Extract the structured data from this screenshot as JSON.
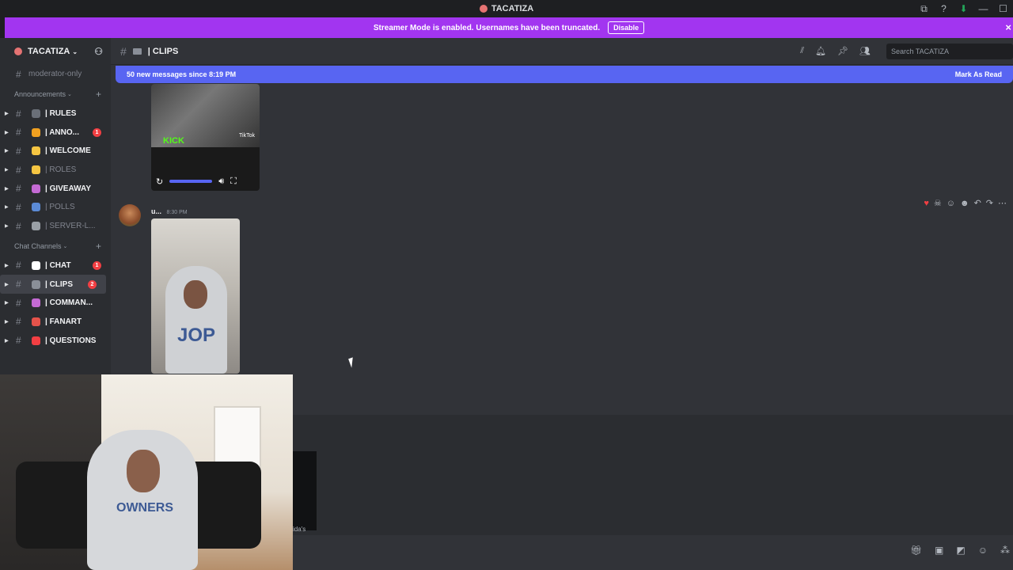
{
  "window": {
    "title": "TACATIZA",
    "controls": [
      "⧉",
      "?",
      "⬇",
      "—",
      "☐"
    ]
  },
  "banner": {
    "text": "Streamer Mode is enabled. Usernames have been truncated.",
    "button": "Disable",
    "close": "×"
  },
  "sidebar": {
    "server_name": "TACATIZA",
    "top_channel": "moderator-only",
    "categories": [
      {
        "name": "Announcements",
        "channels": [
          {
            "label": "| RULES",
            "color": "#6a6f78",
            "badge": "",
            "muted": false
          },
          {
            "label": "| ANNO...",
            "color": "#f0a020",
            "badge": "1",
            "muted": false
          },
          {
            "label": "| WELCOME",
            "color": "#f5c542",
            "badge": "",
            "muted": false
          },
          {
            "label": "| ROLES",
            "color": "#f5c542",
            "badge": "",
            "muted": true
          },
          {
            "label": "| GIVEAWAY",
            "color": "#c46ad4",
            "badge": "",
            "muted": false
          },
          {
            "label": "| POLLS",
            "color": "#5b8bd6",
            "badge": "",
            "muted": true
          },
          {
            "label": "| SERVER-L...",
            "color": "#9aa0a6",
            "badge": "",
            "muted": true
          }
        ]
      },
      {
        "name": "Chat Channels",
        "channels": [
          {
            "label": "| CHAT",
            "color": "#ffffff",
            "badge": "1",
            "muted": false,
            "active": false
          },
          {
            "label": "| CLIPS",
            "color": "#8a8f98",
            "badge": "2",
            "muted": false,
            "active": true
          },
          {
            "label": "| COMMAN...",
            "color": "#c46ad4",
            "badge": "",
            "muted": false
          },
          {
            "label": "| FANART",
            "color": "#e5534b",
            "badge": "",
            "muted": false
          },
          {
            "label": "| QUESTIONS",
            "color": "#f23f43",
            "badge": "",
            "muted": false
          }
        ]
      }
    ]
  },
  "topbar": {
    "channel": "| CLIPS",
    "search_placeholder": "Search TACATIZA"
  },
  "chat": {
    "new_messages": "50 new messages since 8:19 PM",
    "mark_read": "Mark As Read",
    "video": {
      "brand": "KICK",
      "watermark": "TikTok"
    },
    "message": {
      "author": "u...",
      "time": "8:30 PM",
      "shirt_text": "JOP"
    },
    "bottom_caption": "ida's"
  },
  "webcam": {
    "shirt_text": "OWNERS"
  },
  "colors": {
    "accent": "#5865f2",
    "streamer": "#a235f0",
    "badge": "#f23f43"
  }
}
